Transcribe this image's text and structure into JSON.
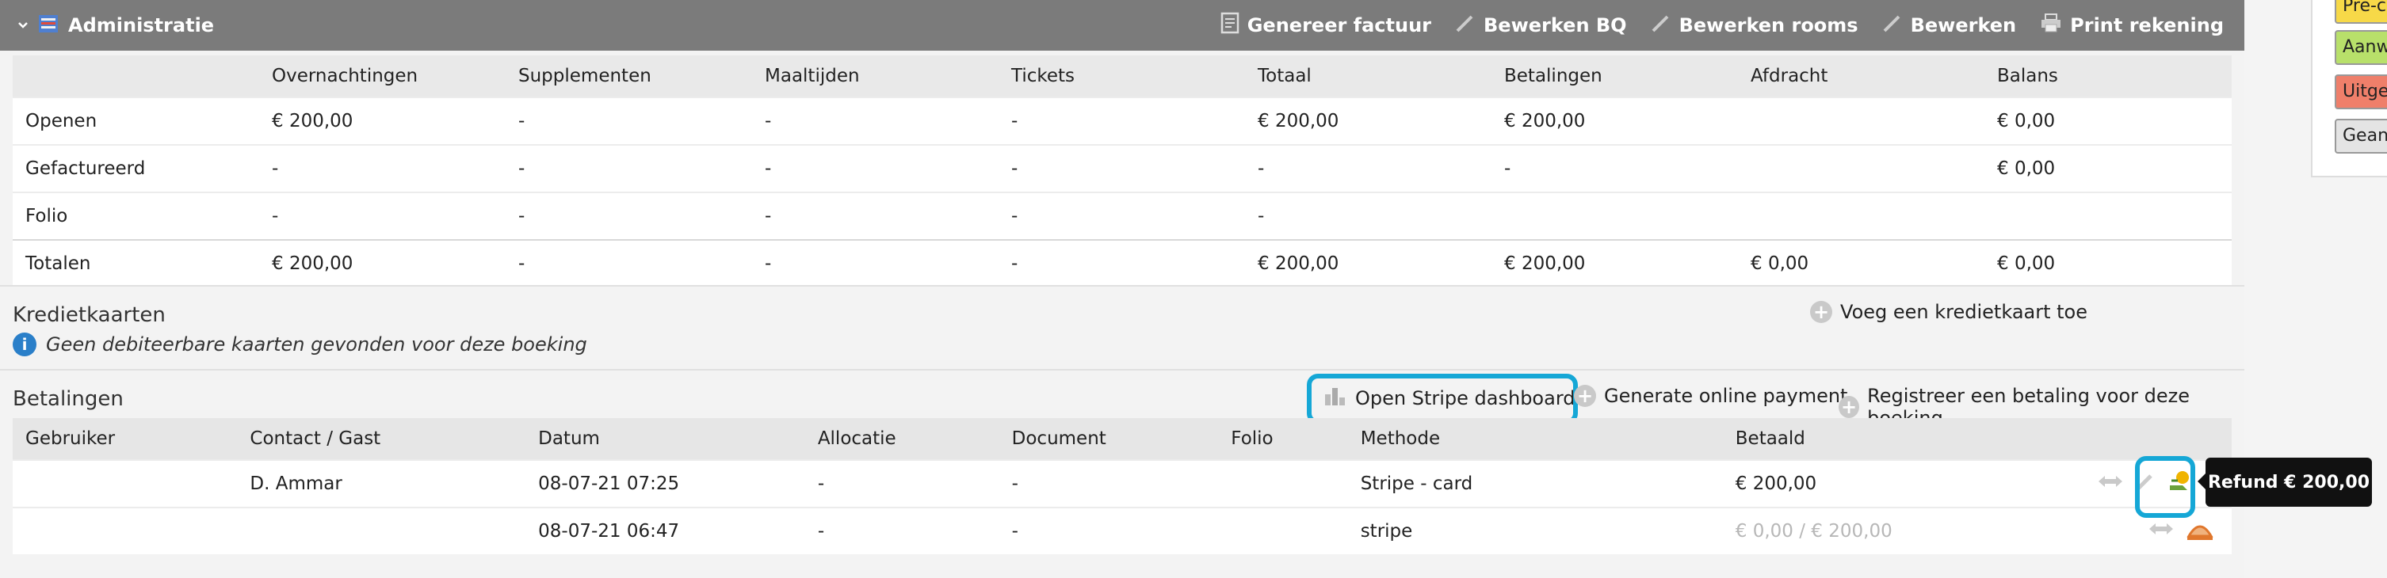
{
  "header": {
    "title": "Administratie",
    "actions": [
      "Genereer factuur",
      "Bewerken BQ",
      "Bewerken rooms",
      "Bewerken",
      "Print rekening"
    ]
  },
  "summary": {
    "columns": [
      "",
      "Overnachtingen",
      "Supplementen",
      "Maaltijden",
      "Tickets",
      "Totaal",
      "Betalingen",
      "Afdracht",
      "Balans"
    ],
    "rows": [
      [
        "Openen",
        "€ 200,00",
        "-",
        "-",
        "-",
        "€ 200,00",
        "€ 200,00",
        "",
        "€ 0,00"
      ],
      [
        "Gefactureerd",
        "-",
        "-",
        "-",
        "-",
        "-",
        "-",
        "",
        "€ 0,00"
      ],
      [
        "Folio",
        "-",
        "-",
        "-",
        "-",
        "-",
        "",
        "",
        ""
      ],
      [
        "Totalen",
        "€ 200,00",
        "-",
        "-",
        "-",
        "€ 200,00",
        "€ 200,00",
        "€ 0,00",
        "€ 0,00"
      ]
    ]
  },
  "creditcards": {
    "title": "Kredietkaarten",
    "note": "Geen debiteerbare kaarten gevonden voor deze boeking",
    "add_label": "Voeg een kredietkaart toe"
  },
  "payments": {
    "title": "Betalingen",
    "stripe_label": "Open Stripe dashboard",
    "generate_label": "Generate online payment",
    "register_label": "Registreer een betaling voor deze boeking",
    "columns": [
      "Gebruiker",
      "Contact / Gast",
      "Datum",
      "Allocatie",
      "Document",
      "Folio",
      "Methode",
      "Betaald",
      ""
    ],
    "rows": [
      [
        "",
        "D. Ammar",
        "08-07-21 07:25",
        "-",
        "-",
        "",
        "Stripe - card",
        "€ 200,00"
      ],
      [
        "",
        "",
        "08-07-21 06:47",
        "-",
        "-",
        "",
        "stripe",
        "€ 0,00 / € 200,00"
      ]
    ],
    "tooltip": "Refund € 200,00"
  },
  "legend": {
    "items": [
      {
        "label": "Pre-check",
        "color": "#f7d948"
      },
      {
        "label": "Aanwezig",
        "color": "#b8e06a"
      },
      {
        "label": "Uitgecheckt",
        "color": "#ef7f6a"
      },
      {
        "label": "Geannuleerd",
        "color": "#e4e4e4"
      }
    ]
  },
  "colors": {
    "header_bg": "#7b7b7b",
    "highlight": "#15a7d6"
  }
}
